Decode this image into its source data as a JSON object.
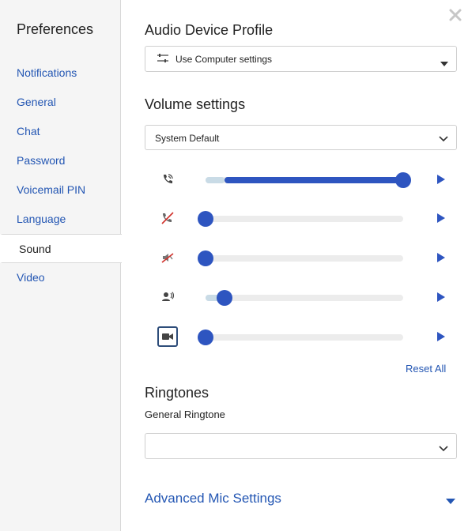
{
  "sidebar": {
    "title": "Preferences",
    "items": [
      {
        "label": "Notifications"
      },
      {
        "label": "General"
      },
      {
        "label": "Chat"
      },
      {
        "label": "Password"
      },
      {
        "label": "Voicemail PIN"
      },
      {
        "label": "Language"
      },
      {
        "label": "Sound",
        "active": true
      },
      {
        "label": "Video"
      }
    ]
  },
  "audio_profile": {
    "heading": "Audio Device Profile",
    "selected": "Use Computer settings",
    "icon": "sliders-icon"
  },
  "volume": {
    "heading": "Volume settings",
    "selected": "System Default",
    "rows": [
      {
        "icon": "phone-call-icon",
        "level": 1.0
      },
      {
        "icon": "phone-muted-icon",
        "level": 0.0
      },
      {
        "icon": "speaker-muted-icon",
        "level": 0.0
      },
      {
        "icon": "user-speaking-icon",
        "level": 0.1
      },
      {
        "icon": "video-camera-icon",
        "level": 0.0
      }
    ],
    "reset_label": "Reset All"
  },
  "ringtones": {
    "heading": "Ringtones",
    "sub_label": "General Ringtone",
    "selected": ""
  },
  "advanced": {
    "label": "Advanced Mic Settings"
  },
  "colors": {
    "accent": "#2e55c0",
    "link": "#2356b3",
    "sidebar_bg": "#f5f5f5"
  }
}
